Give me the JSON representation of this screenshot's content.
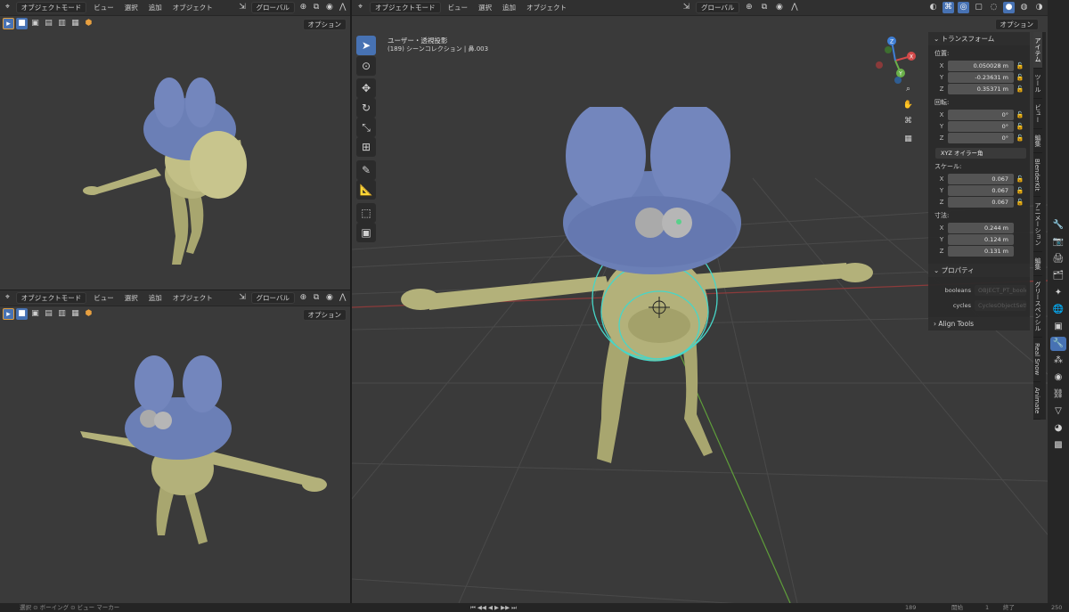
{
  "header": {
    "mode_label": "オブジェクトモード",
    "menus": [
      "ビュー",
      "選択",
      "追加",
      "オブジェクト"
    ],
    "transform_orientation": "グローバル",
    "options_label": "オプション"
  },
  "viewport_main": {
    "view_name": "ユーザー・透視投影",
    "view_info": "(189) シーンコレクション | 鼻.003"
  },
  "npanel": {
    "transform_title": "トランスフォーム",
    "location_label": "位置:",
    "location": {
      "x": "0.050028 m",
      "y": "-0.23631 m",
      "z": "0.35371 m"
    },
    "rotation_label": "回転:",
    "rotation": {
      "x": "0°",
      "y": "0°",
      "z": "0°"
    },
    "rotation_mode": "XYZ オイラー角",
    "scale_label": "スケール:",
    "scale": {
      "x": "0.067",
      "y": "0.067",
      "z": "0.067"
    },
    "dimensions_label": "寸法:",
    "dimensions": {
      "x": "0.244 m",
      "y": "0.124 m",
      "z": "0.131 m"
    },
    "properties_title": "プロパティ",
    "prop_rows": [
      {
        "key": "booleans",
        "value": "OBJECT_PT_booleans"
      },
      {
        "key": "cycles",
        "value": "CyclesObjectSettin"
      }
    ],
    "align_tools": "Align Tools"
  },
  "sidebar_tabs": [
    "アイテム",
    "ツール",
    "ビュー",
    "編集",
    "BlenderKit",
    "アニメーション",
    "編集",
    "グリースペンシル",
    "Real Snow",
    "Animate"
  ],
  "axis_labels": {
    "x": "X",
    "y": "Y",
    "z": "Z"
  },
  "status_bar": {
    "left": "選択  ⊙ ボーイング  ⊙ ビュー  マーカー",
    "frame": "189",
    "start_label": "開始",
    "start": "1",
    "end_label": "終了",
    "end": "250"
  },
  "colors": {
    "accent": "#4772b3",
    "body": "#b3b17a",
    "hat": "#6b7fb6",
    "selection": "#47d6c8"
  }
}
